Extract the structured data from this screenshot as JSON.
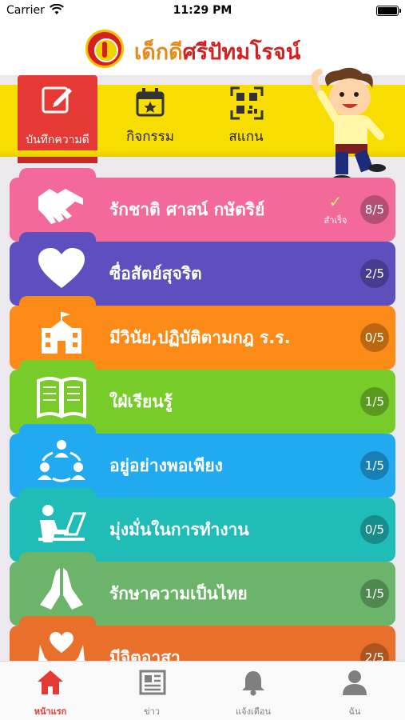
{
  "status_bar": {
    "carrier": "Carrier",
    "time": "11:29 PM"
  },
  "header": {
    "title_part1": "เด็กดี",
    "title_part2": "ศรีปัทมโรจน์"
  },
  "actions": [
    {
      "label": "บันทึกความดี",
      "icon": "edit-icon",
      "active": true
    },
    {
      "label": "กิจกรรม",
      "icon": "calendar-star-icon",
      "active": false
    },
    {
      "label": "สแกน",
      "icon": "qr-code-icon",
      "active": false
    }
  ],
  "categories": [
    {
      "name": "รักชาติ ศาสน์ กษัตริย์",
      "count": "8/5",
      "status": "สำเร็จ",
      "color": "#f2699a",
      "icon": "handshake-icon"
    },
    {
      "name": "ซื่อสัตย์สุจริต",
      "count": "2/5",
      "color": "#5e4fbf",
      "icon": "heart-icon"
    },
    {
      "name": "มีวินัย,ปฏิบัติตามกฎ ร.ร.",
      "count": "0/5",
      "color": "#fb8a16",
      "icon": "school-building-icon"
    },
    {
      "name": "ใฝ่เรียนรู้",
      "count": "1/5",
      "color": "#78cc2a",
      "icon": "open-book-icon"
    },
    {
      "name": "อยู่อย่างพอเพียง",
      "count": "1/5",
      "color": "#21aaf0",
      "icon": "community-icon"
    },
    {
      "name": "มุ่งมั่นในการทำงาน",
      "count": "0/5",
      "color": "#1fbcb8",
      "icon": "person-at-desk-icon"
    },
    {
      "name": "รักษาความเป็นไทย",
      "count": "1/5",
      "color": "#6bb46a",
      "icon": "praying-hands-icon"
    },
    {
      "name": "มีจิตอาสา",
      "count": "2/5",
      "color": "#e9702a",
      "icon": "hands-heart-icon"
    }
  ],
  "tabs": [
    {
      "label": "หน้าแรก",
      "icon": "home-icon",
      "active": true
    },
    {
      "label": "ข่าว",
      "icon": "newspaper-icon",
      "active": false
    },
    {
      "label": "แจ้งเตือน",
      "icon": "bell-icon",
      "active": false
    },
    {
      "label": "ฉัน",
      "icon": "user-icon",
      "active": false
    }
  ],
  "colors": {
    "accent": "#e53935",
    "action_bar": "#f7dd00",
    "tab_inactive": "#7f7f7f"
  }
}
